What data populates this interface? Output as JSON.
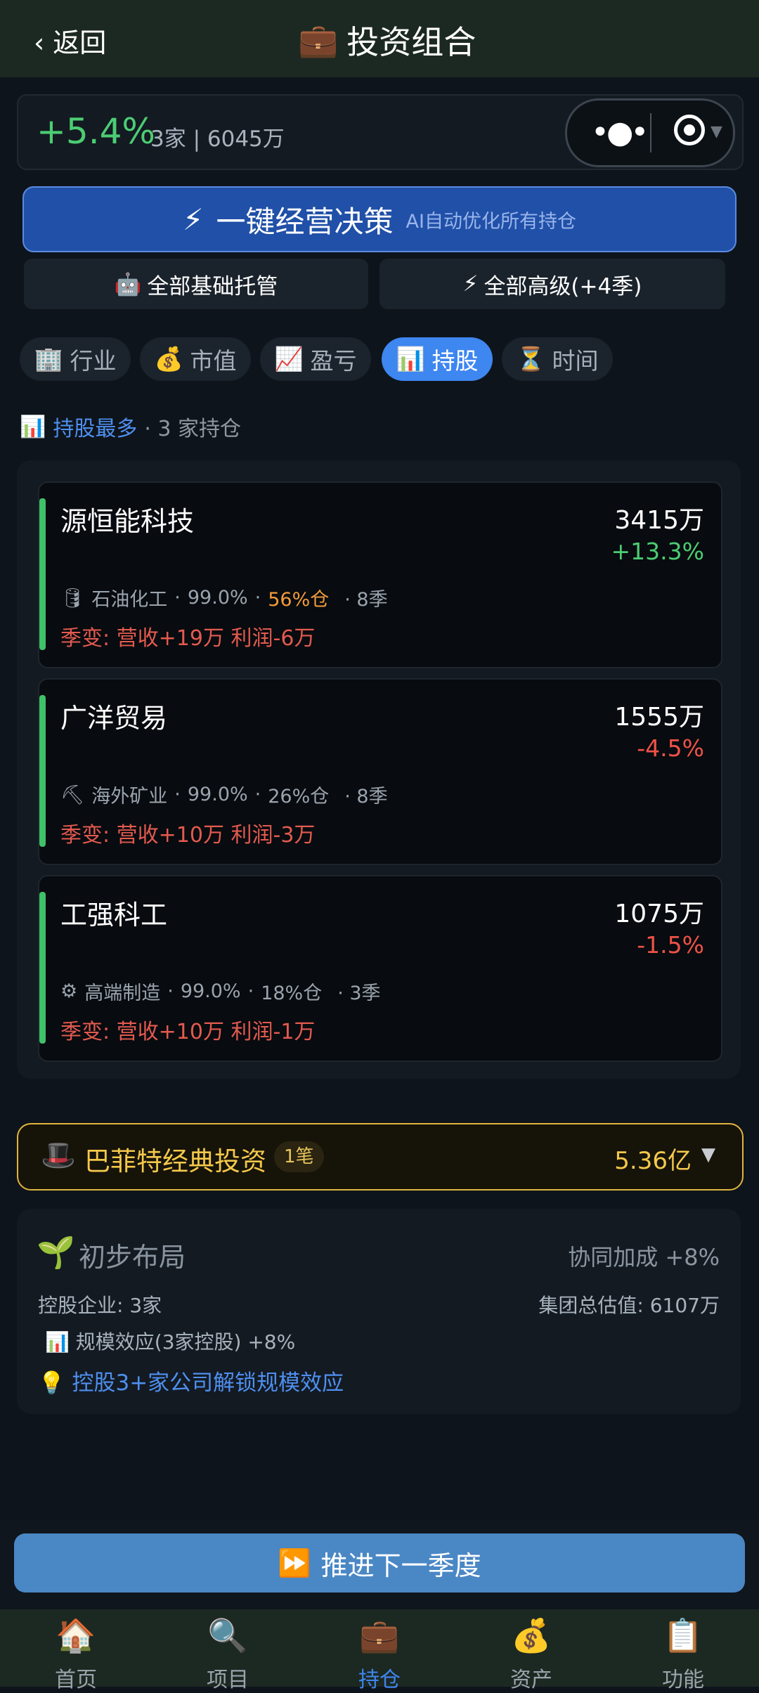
{
  "header": {
    "back_label": "返回",
    "title": "投资组合",
    "title_icon": "💼"
  },
  "summary": {
    "change": "+5.4%",
    "meta": "3家 | 6045万"
  },
  "decision": {
    "icon": "⚡",
    "label": "一键经营决策",
    "sublabel": "AI自动优化所有持仓"
  },
  "bulk_actions": [
    {
      "icon": "🤖",
      "label": "全部基础托管"
    },
    {
      "icon": "⚡",
      "label": "全部高级(+4季)"
    }
  ],
  "filter_tabs": [
    {
      "icon": "🏢",
      "label": "行业",
      "active": false
    },
    {
      "icon": "💰",
      "label": "市值",
      "active": false
    },
    {
      "icon": "📈",
      "label": "盈亏",
      "active": false
    },
    {
      "icon": "📊",
      "label": "持股",
      "active": true
    },
    {
      "icon": "⏳",
      "label": "时间",
      "active": false
    }
  ],
  "sort": {
    "icon": "📊",
    "label": "持股最多",
    "count": "· 3 家持仓"
  },
  "holdings": [
    {
      "name": "源恒能科技",
      "value": "3415万",
      "change": "+13.3%",
      "direction": "up",
      "industry_icon": "🛢",
      "industry": "石油化工",
      "ratio": "99.0%",
      "position": "56%仓",
      "position_highlight": true,
      "seasons": "· 8季",
      "season_change": "季变: 营收+19万 利润-6万"
    },
    {
      "name": "广洋贸易",
      "value": "1555万",
      "change": "-4.5%",
      "direction": "down",
      "industry_icon": "⛏",
      "industry": "海外矿业",
      "ratio": "99.0%",
      "position": "26%仓",
      "position_highlight": false,
      "seasons": "· 8季",
      "season_change": "季变: 营收+10万 利润-3万"
    },
    {
      "name": "工强科工",
      "value": "1075万",
      "change": "-1.5%",
      "direction": "down",
      "industry_icon": "⚙",
      "industry": "高端制造",
      "ratio": "99.0%",
      "position": "18%仓",
      "position_highlight": false,
      "seasons": "· 3季",
      "season_change": "季变: 营收+10万 利润-1万"
    }
  ],
  "buffett": {
    "icon": "🎩",
    "title": "巴菲特经典投资",
    "badge": "1笔",
    "amount": "5.36亿",
    "arrow": "▼"
  },
  "stage": {
    "icon": "🌱",
    "title": "初步布局",
    "synergy": "协同加成 +8%",
    "controlled": "控股企业: 3家",
    "total_value": "集团总估值: 6107万",
    "scale_icon": "📊",
    "scale_effect": "规模效应(3家控股) +8%",
    "tip_icon": "💡",
    "tip": "控股3+家公司解锁规模效应"
  },
  "advance": {
    "icon": "⏩",
    "label": "推进下一季度"
  },
  "nav": [
    {
      "icon": "🏠",
      "label": "首页",
      "active": false
    },
    {
      "icon": "🔍",
      "label": "项目",
      "active": false
    },
    {
      "icon": "💼",
      "label": "持仓",
      "active": true
    },
    {
      "icon": "💰",
      "label": "资产",
      "active": false
    },
    {
      "icon": "📋",
      "label": "功能",
      "active": false
    }
  ],
  "colors": {
    "up": "#4ccd73",
    "down": "#ef5248",
    "accent": "#3e86f0",
    "gold": "#f4c84b"
  }
}
